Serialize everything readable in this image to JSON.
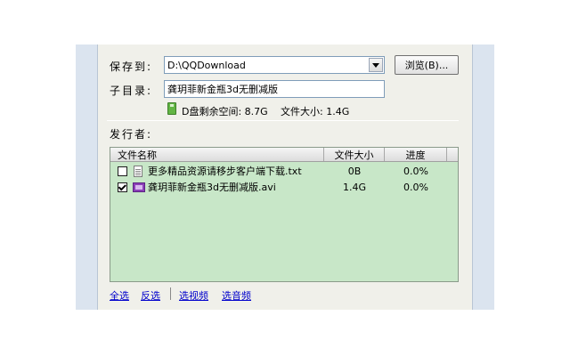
{
  "form": {
    "save_to_label": "保存到:",
    "save_path": "D:\\QQDownload",
    "browse_label": "浏览(B)...",
    "subdir_label": "子目录:",
    "subdir_value": "龚玥菲新金瓶3d无删减版",
    "disk_free": "D盘剩余空间: 8.7G",
    "file_size": "文件大小: 1.4G",
    "publisher_label": "发行者:"
  },
  "file_list": {
    "columns": [
      "文件名称",
      "文件大小",
      "进度"
    ],
    "rows": [
      {
        "name": "更多精品资源请移步客户端下载.txt",
        "size": "0B",
        "progress": "0.0%",
        "checked": false,
        "icon": "text-file-icon"
      },
      {
        "name": "龚玥菲新金瓶3d无删减版.avi",
        "size": "1.4G",
        "progress": "0.0%",
        "checked": true,
        "icon": "video-file-icon"
      }
    ]
  },
  "footer": {
    "select_all": "全选",
    "invert": "反选",
    "select_video": "选视频",
    "select_audio": "选音频"
  },
  "colors": {
    "list_bg": "#c8e7c8",
    "dialog_bg": "#f0f0ea",
    "link": "#0000cc"
  }
}
